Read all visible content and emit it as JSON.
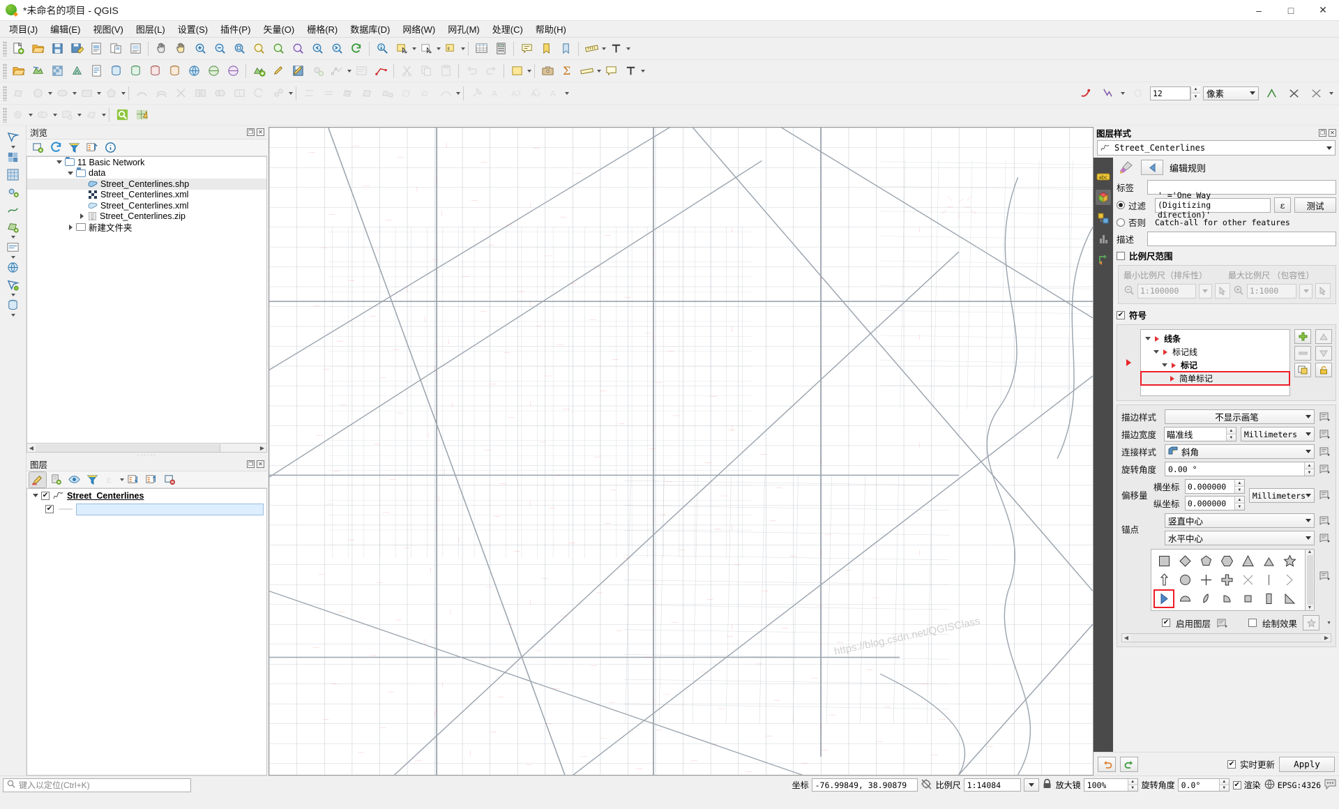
{
  "window": {
    "title": "*未命名的项目 - QGIS",
    "minimize": "–",
    "maximize": "□",
    "close": "✕"
  },
  "menubar": [
    {
      "label": "项目(J)"
    },
    {
      "label": "编辑(E)"
    },
    {
      "label": "视图(V)"
    },
    {
      "label": "图层(L)"
    },
    {
      "label": "设置(S)"
    },
    {
      "label": "插件(P)"
    },
    {
      "label": "矢量(O)"
    },
    {
      "label": "栅格(R)"
    },
    {
      "label": "数据库(D)"
    },
    {
      "label": "网络(W)"
    },
    {
      "label": "网孔(M)"
    },
    {
      "label": "处理(C)"
    },
    {
      "label": "帮助(H)"
    }
  ],
  "digitizing_toolbar": {
    "size_value": "12",
    "unit_value": "像素"
  },
  "browser": {
    "title": "浏览",
    "toolbar_icons": [
      "add-layer-icon",
      "refresh-icon",
      "filter-icon",
      "collapse-all-icon",
      "info-icon"
    ],
    "tree": [
      {
        "label": "11 Basic Network",
        "depth": 2,
        "type": "folder",
        "expander": "down"
      },
      {
        "label": "data",
        "depth": 3,
        "type": "folder",
        "expander": "down"
      },
      {
        "label": "Street_Centerlines.shp",
        "depth": 4,
        "type": "vector",
        "expander": "none",
        "selected": true
      },
      {
        "label": "Street_Centerlines.xml",
        "depth": 4,
        "type": "raster",
        "expander": "none"
      },
      {
        "label": "Street_Centerlines.xml",
        "depth": 4,
        "type": "vector",
        "expander": "none"
      },
      {
        "label": "Street_Centerlines.zip",
        "depth": 4,
        "type": "zip",
        "expander": "right"
      },
      {
        "label": "新建文件夹",
        "depth": 3,
        "type": "folder-plain",
        "expander": "right"
      }
    ]
  },
  "layers": {
    "title": "图层",
    "toolbar_icons": [
      "open-styling-panel-icon",
      "add-group-icon",
      "manage-visibility-icon",
      "filter-legend-icon",
      "expression-filter-icon",
      "expand-all-icon",
      "collapse-all-icon",
      "remove-layer-icon"
    ],
    "items": [
      {
        "label": "Street_Centerlines",
        "checked": true,
        "bold": true
      }
    ],
    "sub_item": {
      "checked": true,
      "symbol_label": ""
    }
  },
  "styling": {
    "title": "图层样式",
    "layer_name": "Street_Centerlines",
    "section_header": "编辑规则",
    "label_label": "标签",
    "label_value": "",
    "filter_radio_label": "过滤",
    "filter_value": "' ='One Way (Digitizing direction)'",
    "expression_button": "ε",
    "test_button": "测试",
    "else_radio_label": "否则",
    "else_hint": "Catch-all for other features",
    "description_label": "描述",
    "description_value": "",
    "scale_range_label": "比例尺范围",
    "scale_range_checked": false,
    "min_scale_label": "最小比例尺（排斥性）",
    "min_scale_value": "1:100000",
    "max_scale_label": "最大比例尺 （包容性）",
    "max_scale_value": "1:1000",
    "symbol_label": "符号",
    "symbol_checked": true,
    "symbol_tree": [
      {
        "label": "线条",
        "depth": 0,
        "bold": true,
        "expander": "down"
      },
      {
        "label": "标记线",
        "depth": 1,
        "bold": false,
        "expander": "down"
      },
      {
        "label": "标记",
        "depth": 2,
        "bold": true,
        "expander": "down"
      },
      {
        "label": "简单标记",
        "depth": 3,
        "bold": false,
        "expander": "none",
        "highlighted": true
      }
    ],
    "tree_buttons": [
      "add-symbol-layer-icon",
      "remove-symbol-layer-icon",
      "duplicate-symbol-layer-icon",
      "lock-colors-icon",
      "move-up-icon",
      "move-down-icon"
    ],
    "props": [
      {
        "label": "描边样式",
        "type": "combo",
        "value": "不显示画笔",
        "centered": true
      },
      {
        "label": "描边宽度",
        "type": "spin-unit",
        "value": "瞄准线",
        "unit": "Millimeters"
      },
      {
        "label": "连接样式",
        "type": "combo-icon",
        "value": "斜角"
      },
      {
        "label": "旋转角度",
        "type": "spin",
        "value": "0.00 °"
      }
    ],
    "offset_label": "偏移量",
    "offset_x_label": "横坐标",
    "offset_x_value": "0.000000",
    "offset_y_label": "纵坐标",
    "offset_y_value": "0.000000",
    "offset_unit": "Millimeters",
    "anchor_label": "锚点",
    "anchor_v_value": "竖直中心",
    "anchor_h_value": "水平中心",
    "shapes": [
      {
        "name": "square",
        "selected": false
      },
      {
        "name": "diamond",
        "selected": false
      },
      {
        "name": "pentagon",
        "selected": false
      },
      {
        "name": "hexagon",
        "selected": false
      },
      {
        "name": "triangle",
        "selected": false
      },
      {
        "name": "equilateral-triangle",
        "selected": false
      },
      {
        "name": "star",
        "selected": false
      },
      {
        "name": "arrow",
        "selected": false
      },
      {
        "name": "circle",
        "selected": false
      },
      {
        "name": "cross",
        "selected": false
      },
      {
        "name": "cross-fill",
        "selected": false
      },
      {
        "name": "x",
        "selected": false
      },
      {
        "name": "line",
        "selected": false
      },
      {
        "name": "half-arc",
        "selected": false
      },
      {
        "name": "right-half-triangle",
        "selected": true
      },
      {
        "name": "half-square-rounded",
        "selected": false
      },
      {
        "name": "quarter-disc",
        "selected": false
      },
      {
        "name": "quarter-circle",
        "selected": false
      },
      {
        "name": "half-square",
        "selected": false
      },
      {
        "name": "third-square",
        "selected": false
      },
      {
        "name": "right-triangle",
        "selected": false
      }
    ],
    "enable_layer_label": "启用图层",
    "enable_layer_checked": true,
    "draw_effects_label": "绘制效果",
    "draw_effects_checked": false,
    "live_update_label": "实时更新",
    "live_update_checked": true,
    "apply_button": "Apply",
    "undo_icon": "undo-icon",
    "redo_icon": "redo-icon"
  },
  "statusbar": {
    "locator_placeholder": "键入以定位(Ctrl+K)",
    "coordinate_label": "坐标",
    "coordinate_value": "-76.99849, 38.90879",
    "scale_label": "比例尺",
    "scale_value": "1:14084",
    "magnifier_label": "放大镜",
    "magnifier_value": "100%",
    "rotation_label": "旋转角度",
    "rotation_value": "0.0°",
    "render_label": "渲染",
    "render_checked": true,
    "crs_label": "EPSG:4326"
  },
  "watermark": "https://blog.csdn.net/QGISClass",
  "colors": {
    "accent_red": "#ee1c25",
    "marker_red": "#e8262a",
    "street_gray": "#9aa3ad",
    "panel_bg": "#f0f0f0",
    "tab_dark": "#4a4a4a"
  }
}
